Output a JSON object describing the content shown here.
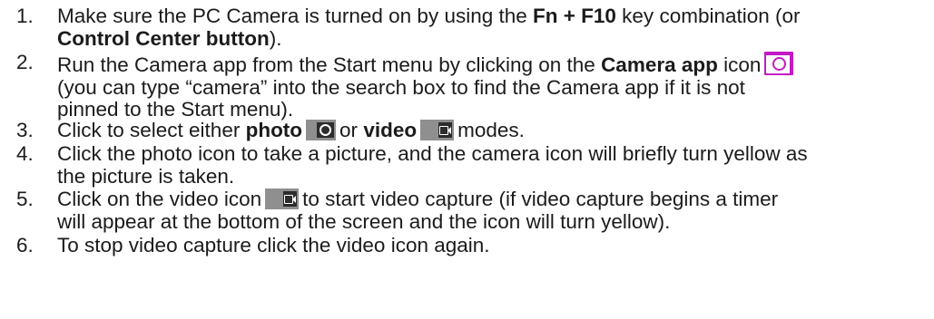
{
  "steps": [
    {
      "number": "1.",
      "lines": [
        [
          "Make sure the PC Camera is turned on by using the ",
          "Fn + F10",
          " key combination (or"
        ],
        [
          "Control Center button",
          ")."
        ]
      ]
    },
    {
      "number": "2.",
      "lines": [
        [
          "Run the Camera app from the Start menu by clicking on the ",
          "Camera app",
          " icon"
        ],
        [
          "(you can type “camera” into the search box to find the Camera app if it is not"
        ],
        [
          "pinned to the Start menu)."
        ]
      ]
    },
    {
      "number": "3.",
      "lines": [
        [
          "Click to select either ",
          "photo",
          "or ",
          "video",
          "modes."
        ]
      ]
    },
    {
      "number": "4.",
      "lines": [
        [
          "Click the photo icon to take a picture, and the camera icon will briefly turn yellow as"
        ],
        [
          "the picture is taken."
        ]
      ]
    },
    {
      "number": "5.",
      "lines": [
        [
          "Click on the video icon",
          "to start video capture (if video capture begins a timer"
        ],
        [
          "will appear at the bottom of the screen and the icon will turn yellow)."
        ]
      ]
    },
    {
      "number": "6.",
      "lines": [
        [
          "To stop video capture click the video icon again."
        ]
      ]
    }
  ],
  "icons": {
    "camera_app": "camera-app-icon",
    "photo_mode": "photo-mode-icon",
    "video_mode": "video-mode-icon",
    "video_capture": "video-icon"
  },
  "colors": {
    "camera_app_icon": "#c21ac6",
    "mode_icon": "#8f8f8f",
    "text": "#1b1b1b"
  }
}
